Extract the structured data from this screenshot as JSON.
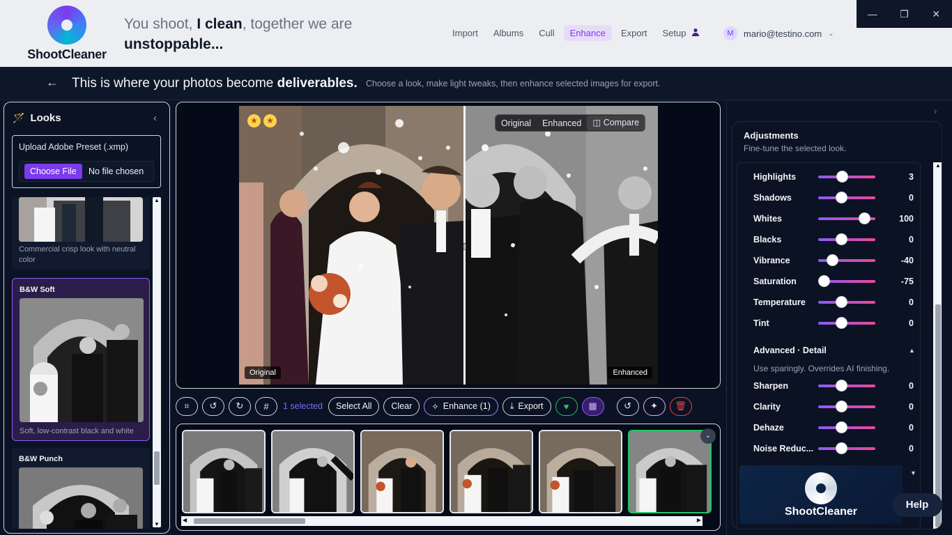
{
  "app": {
    "brand": "ShootCleaner"
  },
  "header": {
    "tagline_1": "You shoot, ",
    "tagline_bold_1": "I clean",
    "tagline_2": ", together we are",
    "tagline_bold_2": "unstoppable...",
    "nav": [
      {
        "label": "Import"
      },
      {
        "label": "Albums"
      },
      {
        "label": "Cull"
      },
      {
        "label": "Enhance",
        "active": true
      },
      {
        "label": "Export"
      },
      {
        "label": "Setup"
      }
    ],
    "avatar_letter": "M",
    "account_email": "mario@testino.com"
  },
  "subheader": {
    "title_plain": "This is where your photos become ",
    "title_bold": "deliverables.",
    "description": "Choose a look, make light tweaks, then enhance selected images for export."
  },
  "looks": {
    "title": "Looks",
    "upload_label": "Upload Adobe Preset (.xmp)",
    "choose_file": "Choose File",
    "no_file": "No file chosen",
    "items": [
      {
        "name": "",
        "desc": "Commercial crisp look with neutral color"
      },
      {
        "name": "B&W Soft",
        "desc": "Soft, low-contrast black and white",
        "selected": true
      },
      {
        "name": "B&W Punch",
        "desc": ""
      }
    ]
  },
  "preview": {
    "compare_options": [
      "Original",
      "Enhanced",
      "Compare"
    ],
    "active_compare": "Compare",
    "label_left": "Original",
    "label_right": "Enhanced",
    "stars": 2
  },
  "toolbar": {
    "selected_count": "1 selected",
    "select_all": "Select All",
    "clear": "Clear",
    "enhance": "Enhance (1)",
    "export": "Export"
  },
  "filmstrip": {
    "count": 6,
    "selected_index": 5
  },
  "adjustments": {
    "title": "Adjustments",
    "subtitle": "Fine-tune the selected look.",
    "sliders": [
      {
        "label": "Highlights",
        "value": 3
      },
      {
        "label": "Shadows",
        "value": 0
      },
      {
        "label": "Whites",
        "value": 100
      },
      {
        "label": "Blacks",
        "value": 0
      },
      {
        "label": "Vibrance",
        "value": -40
      },
      {
        "label": "Saturation",
        "value": -75
      },
      {
        "label": "Temperature",
        "value": 0
      },
      {
        "label": "Tint",
        "value": 0
      }
    ],
    "advanced_title": "Advanced · Detail",
    "advanced_note": "Use sparingly. Overrides AI finishing.",
    "advanced_sliders": [
      {
        "label": "Sharpen",
        "value": 0
      },
      {
        "label": "Clarity",
        "value": 0
      },
      {
        "label": "Dehaze",
        "value": 0
      },
      {
        "label": "Noise Reduc...",
        "value": 0
      }
    ]
  },
  "promo": {
    "brand": "ShootCleaner"
  },
  "help": {
    "label": "Help"
  },
  "colors": {
    "accent": "#7c3aed",
    "selected_green": "#22c55e",
    "danger": "#ef4444"
  }
}
